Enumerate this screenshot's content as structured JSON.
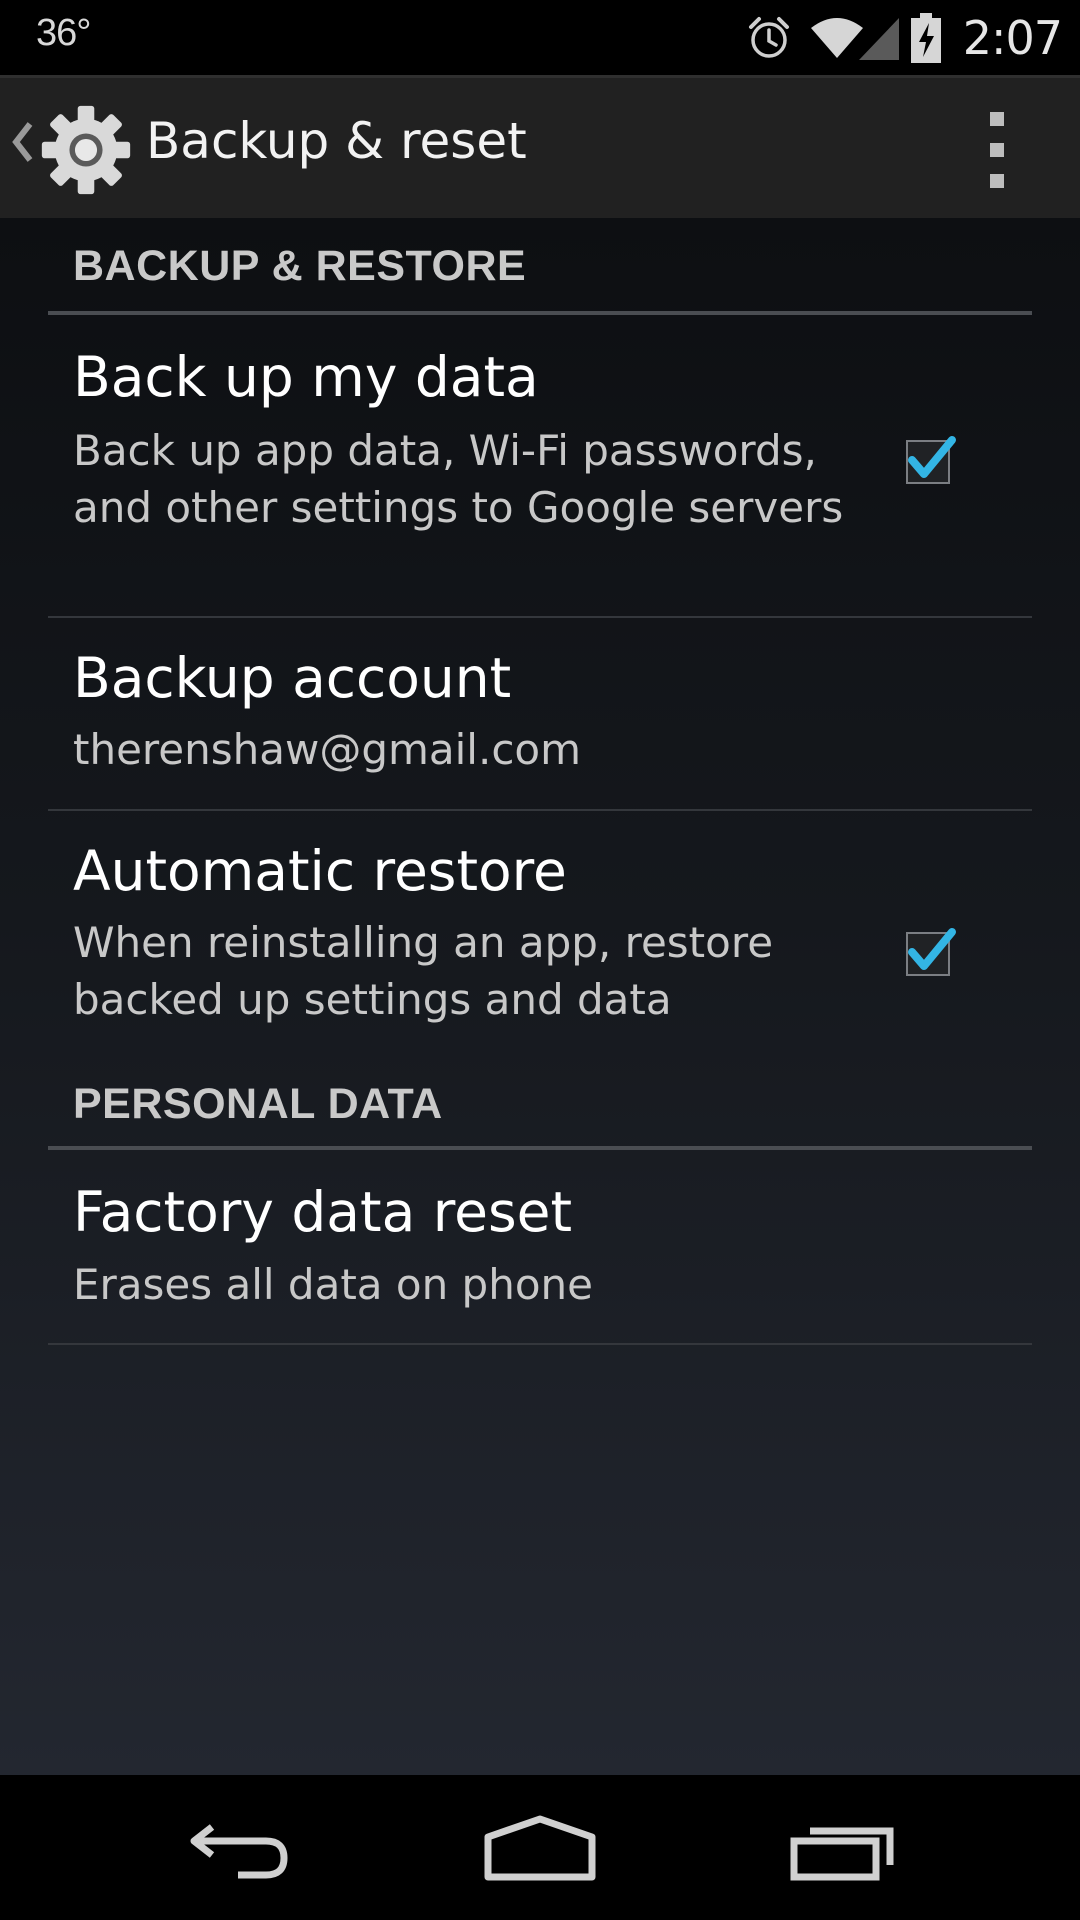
{
  "status_bar": {
    "temperature": "36°",
    "time": "2:07",
    "icons": [
      "alarm-icon",
      "wifi-icon",
      "cell-signal-icon",
      "battery-charging-icon"
    ]
  },
  "action_bar": {
    "title": "Backup & reset",
    "icons": [
      "up-caret-icon",
      "settings-gear-icon",
      "overflow-menu-icon"
    ]
  },
  "sections": {
    "backup_restore": {
      "header": "BACKUP & RESTORE",
      "items": {
        "backup_data": {
          "title": "Back up my data",
          "summary": "Back up app data, Wi-Fi passwords, and other settings to Google servers",
          "checked": true
        },
        "backup_account": {
          "title": "Backup account",
          "summary": "therenshaw@gmail.com"
        },
        "auto_restore": {
          "title": "Automatic restore",
          "summary": "When reinstalling an app, restore backed up settings and data",
          "checked": true
        }
      }
    },
    "personal_data": {
      "header": "PERSONAL DATA",
      "items": {
        "factory_reset": {
          "title": "Factory data reset",
          "summary": "Erases all data on phone"
        }
      }
    }
  },
  "nav_bar": {
    "icons": [
      "back-icon",
      "home-icon",
      "recents-icon"
    ]
  },
  "colors": {
    "accent": "#33b5e5",
    "action_bar": "#212121",
    "text_primary": "#ffffff",
    "text_secondary": "#c8c8c8"
  }
}
